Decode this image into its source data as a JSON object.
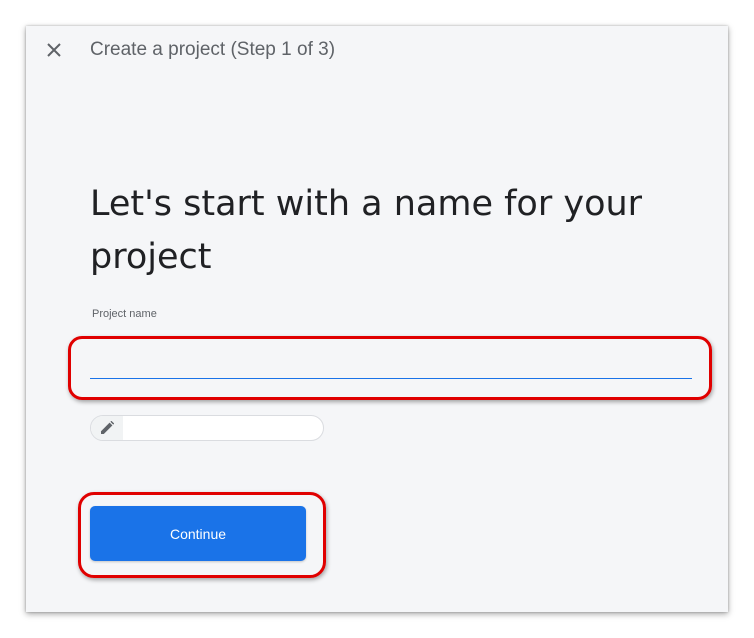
{
  "header": {
    "title": "Create a project (Step 1 of 3)",
    "close_icon": "close-icon"
  },
  "main": {
    "heading": "Let's start with a name for your project",
    "project_name": {
      "label": "Project name",
      "value": "",
      "placeholder": ""
    },
    "project_id_chip": {
      "icon": "pencil-icon",
      "text": ""
    },
    "continue_label": "Continue"
  },
  "colors": {
    "accent": "#1a73e8",
    "dialog_background": "#f5f6f8",
    "annotation_highlight": "#e00000"
  }
}
